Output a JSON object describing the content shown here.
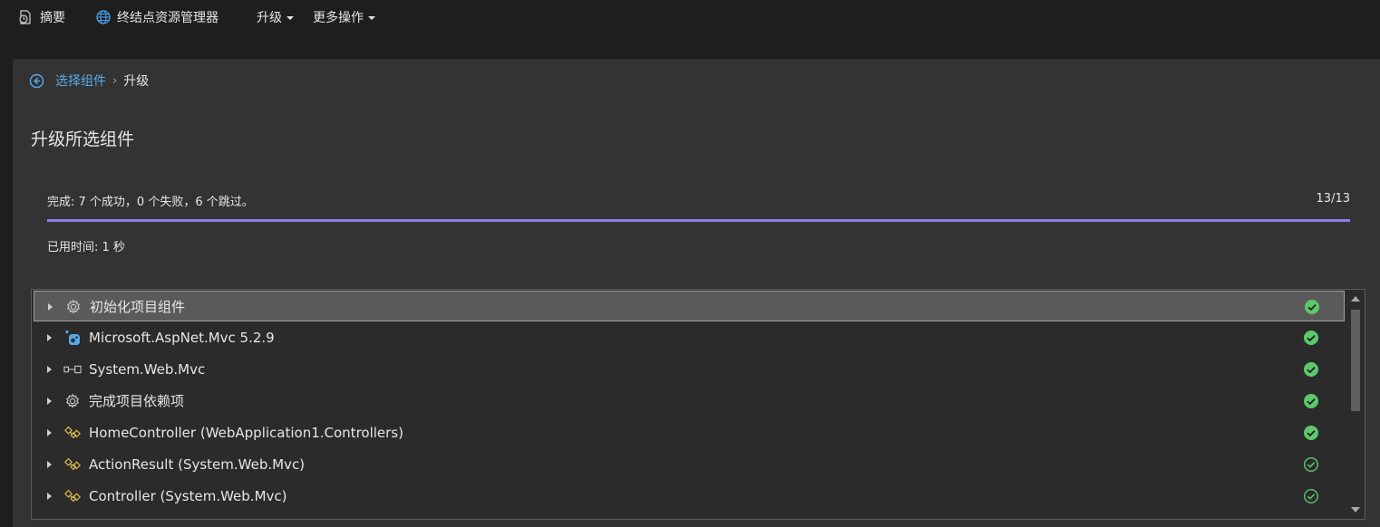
{
  "topnav": {
    "summary_label": "摘要",
    "endpoints_label": "终结点资源管理器",
    "upgrade_label": "升级",
    "more_label": "更多操作"
  },
  "breadcrumb": {
    "back_label": "选择组件",
    "separator": "›",
    "current": "升级"
  },
  "page_title": "升级所选组件",
  "status": {
    "summary": "完成: 7 个成功，0 个失败，6 个跳过。",
    "count": "13/13",
    "progress": 1.0,
    "elapsed": "已用时间: 1 秒"
  },
  "colors": {
    "accent_link": "#5aa8e8",
    "progress": "#8f7ee6",
    "success": "#5cc96b"
  },
  "list": {
    "rows": [
      {
        "label": "初始化项目组件",
        "icon": "gear-icon",
        "status": "success-filled",
        "selected": true
      },
      {
        "label": "Microsoft.AspNet.Mvc 5.2.9",
        "icon": "nuget-package-icon",
        "status": "success-filled",
        "selected": false
      },
      {
        "label": "System.Web.Mvc",
        "icon": "reference-icon",
        "status": "success-filled",
        "selected": false
      },
      {
        "label": "完成项目依赖项",
        "icon": "gear-icon",
        "status": "success-filled",
        "selected": false
      },
      {
        "label": "HomeController (WebApplication1.Controllers)",
        "icon": "class-icon",
        "status": "success-filled",
        "selected": false
      },
      {
        "label": "ActionResult (System.Web.Mvc)",
        "icon": "class-icon",
        "status": "success-outline",
        "selected": false
      },
      {
        "label": "Controller (System.Web.Mvc)",
        "icon": "class-icon",
        "status": "success-outline",
        "selected": false
      }
    ]
  }
}
